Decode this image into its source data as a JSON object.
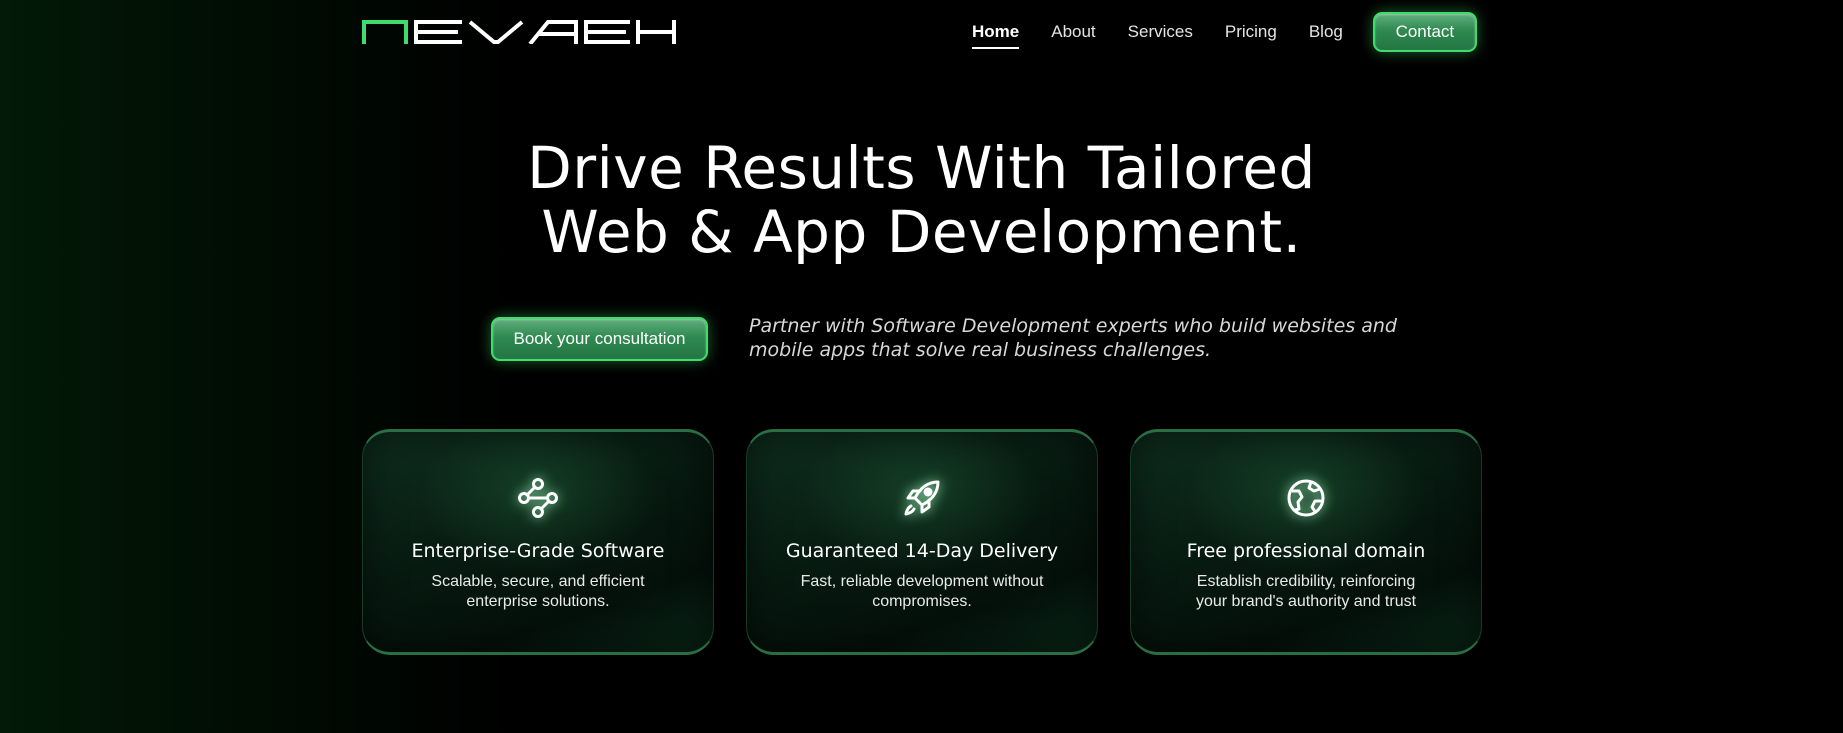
{
  "brand": {
    "name": "NEVAEH",
    "accent_color": "#3fdc6d"
  },
  "nav": {
    "links": [
      {
        "label": "Home",
        "active": true
      },
      {
        "label": "About",
        "active": false
      },
      {
        "label": "Services",
        "active": false
      },
      {
        "label": "Pricing",
        "active": false
      },
      {
        "label": "Blog",
        "active": false
      }
    ],
    "contact_label": "Contact"
  },
  "hero": {
    "title_line1": "Drive Results With Tailored",
    "title_line2": "Web & App Development.",
    "cta_label": "Book your consultation",
    "subtitle_line1": "Partner with Software Development experts who build websites and",
    "subtitle_line2": "mobile apps that solve real business challenges."
  },
  "features": [
    {
      "icon": "connection-nodes-icon",
      "title": "Enterprise-Grade Software",
      "desc_line1": "Scalable, secure, and efficient",
      "desc_line2": "enterprise solutions."
    },
    {
      "icon": "rocket-icon",
      "title": "Guaranteed 14-Day Delivery",
      "desc_line1": "Fast, reliable development without",
      "desc_line2": "compromises."
    },
    {
      "icon": "globe-icon",
      "title": "Free professional domain",
      "desc_line1": "Establish credibility, reinforcing",
      "desc_line2": "your brand's authority and trust"
    }
  ]
}
